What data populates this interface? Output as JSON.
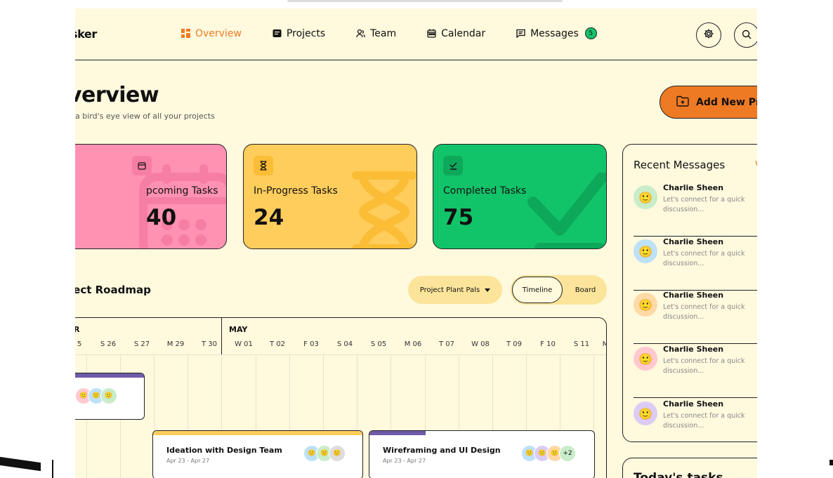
{
  "app": {
    "logo": "sker"
  },
  "nav": {
    "items": [
      {
        "label": "Overview",
        "icon": "grid-icon"
      },
      {
        "label": "Projects",
        "icon": "folder-icon"
      },
      {
        "label": "Team",
        "icon": "team-icon"
      },
      {
        "label": "Calendar",
        "icon": "calendar-icon"
      },
      {
        "label": "Messages",
        "icon": "chat-icon",
        "badge": "5"
      }
    ],
    "active": "Overview"
  },
  "header": {
    "title": "verview",
    "subtitle": "a bird's eye view of all your projects",
    "add_button": "Add New Pr"
  },
  "stats": {
    "upcoming": {
      "label": "pcoming Tasks",
      "value": "40",
      "color": "#ff92b3"
    },
    "inprogress": {
      "label": "In-Progress Tasks",
      "value": "24",
      "color": "#ffcd5c"
    },
    "completed": {
      "label": "Completed Tasks",
      "value": "75",
      "color": "#12c469"
    }
  },
  "roadmap": {
    "title": "ject Roadmap",
    "project_select": "Project Plant Pals",
    "views": [
      "Timeline",
      "Board"
    ],
    "months": [
      "R",
      "MAY"
    ],
    "days": [
      "5",
      "S 26",
      "S 27",
      "M 29",
      "T 30",
      "W 01",
      "T 02",
      "F 03",
      "S 04",
      "S 05",
      "M 06",
      "T 07",
      "W 08",
      "T 09",
      "F 10",
      "S 11",
      "M"
    ],
    "tasks": [
      {
        "name": "Ideation with Design Team",
        "date": "Apr 23 - Apr 27",
        "color": "#ffcd5c"
      },
      {
        "name": "Wireframing and UI Design",
        "date": "Apr 23 - Apr 27",
        "color": "#6f5aa8",
        "extra": "+2"
      }
    ]
  },
  "messages": {
    "title": "Recent Messages",
    "items": [
      {
        "name": "Charlie Sheen",
        "text": "Let's connect for a quick discussion...",
        "bg": "#c9ecc9"
      },
      {
        "name": "Charlie Sheen",
        "text": "Let's connect for a quick discussion...",
        "bg": "#bde1f7"
      },
      {
        "name": "Charlie Sheen",
        "text": "Let's connect for a quick discussion...",
        "bg": "#ffd9a6"
      },
      {
        "name": "Charlie Sheen",
        "text": "Let's connect for a quick discussion...",
        "bg": "#ffc9cf"
      },
      {
        "name": "Charlie Sheen",
        "text": "Let's connect for a quick discussion...",
        "bg": "#dcccf5"
      }
    ]
  },
  "today": {
    "title": "Today's tasks"
  }
}
